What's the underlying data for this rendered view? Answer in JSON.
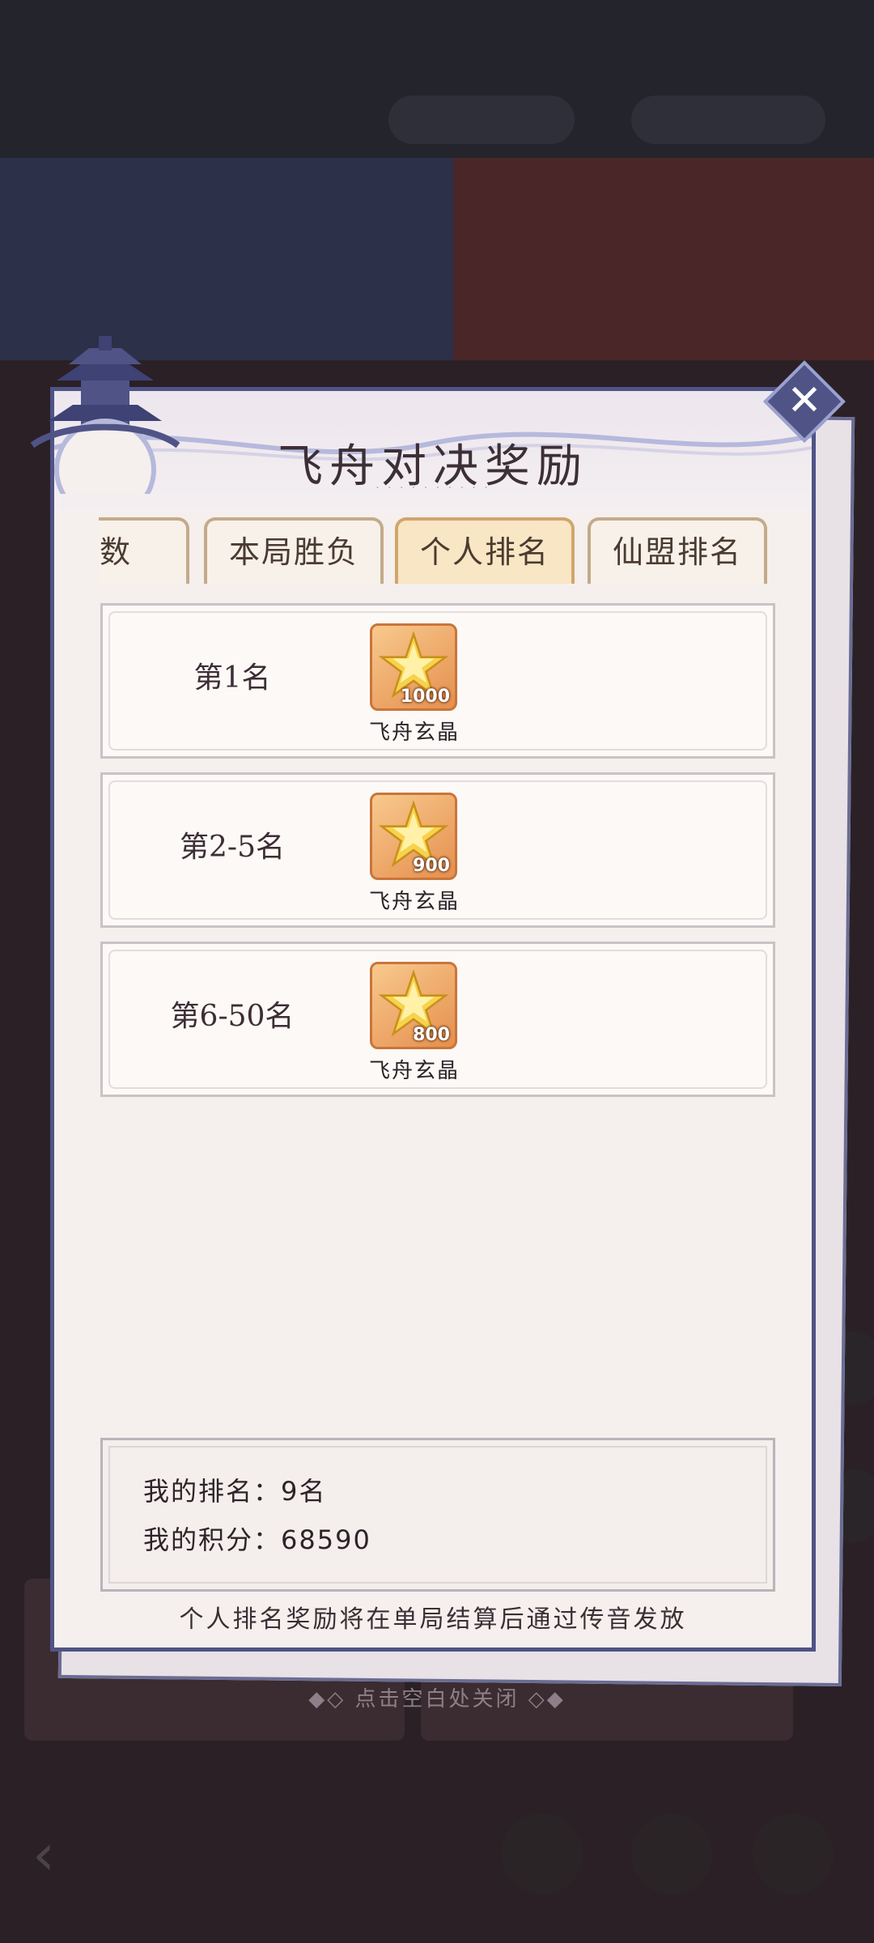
{
  "modal": {
    "title": "飞舟对决奖励",
    "close_icon": "close-icon",
    "tabs": [
      {
        "label": "次数",
        "active": false
      },
      {
        "label": "本局胜负",
        "active": false
      },
      {
        "label": "个人排名",
        "active": true
      },
      {
        "label": "仙盟排名",
        "active": false
      }
    ],
    "rewards": [
      {
        "rank": "第1名",
        "item": "飞舟玄晶",
        "qty": "1000",
        "icon": "star-crystal-icon"
      },
      {
        "rank": "第2-5名",
        "item": "飞舟玄晶",
        "qty": "900",
        "icon": "star-crystal-icon"
      },
      {
        "rank": "第6-50名",
        "item": "飞舟玄晶",
        "qty": "800",
        "icon": "star-crystal-icon"
      }
    ],
    "my_rank_label": "我的排名：",
    "my_rank_value": "9名",
    "my_score_label": "我的积分：",
    "my_score_value": "68590",
    "footer_note": "个人排名奖励将在单局结算后通过传音发放"
  },
  "dismiss_hint": "◆◇ 点击空白处关闭 ◇◆",
  "colors": {
    "modal_border": "#4f5386",
    "active_tab": "#f8e6c4",
    "icon_bg": "#e58f4e"
  }
}
